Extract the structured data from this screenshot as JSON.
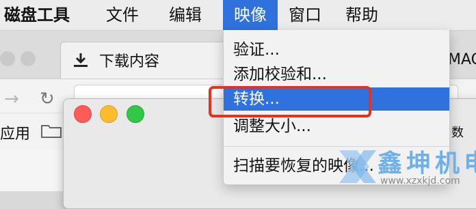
{
  "menubar": {
    "app": "磁盘工具",
    "items": [
      "文件",
      "编辑",
      "映像",
      "窗口",
      "帮助"
    ],
    "active_index": 2
  },
  "browser": {
    "tab_title": "下载内容",
    "tab_right_fragment": "MAC",
    "bookmark_apps": "应用",
    "bookmark_right_fragment": "数"
  },
  "image_menu": {
    "items": [
      {
        "label": "验证..."
      },
      {
        "label": "添加校验和..."
      },
      {
        "label": "转换...",
        "selected": true
      },
      {
        "label": "调整大小..."
      },
      {
        "label": "扫描要恢复的映像..."
      }
    ]
  },
  "watermark": {
    "text": "鑫坤机电",
    "url": "www.xzxkjd.com"
  },
  "colors": {
    "accent": "#2f72de",
    "highlight": "#e8301f"
  }
}
